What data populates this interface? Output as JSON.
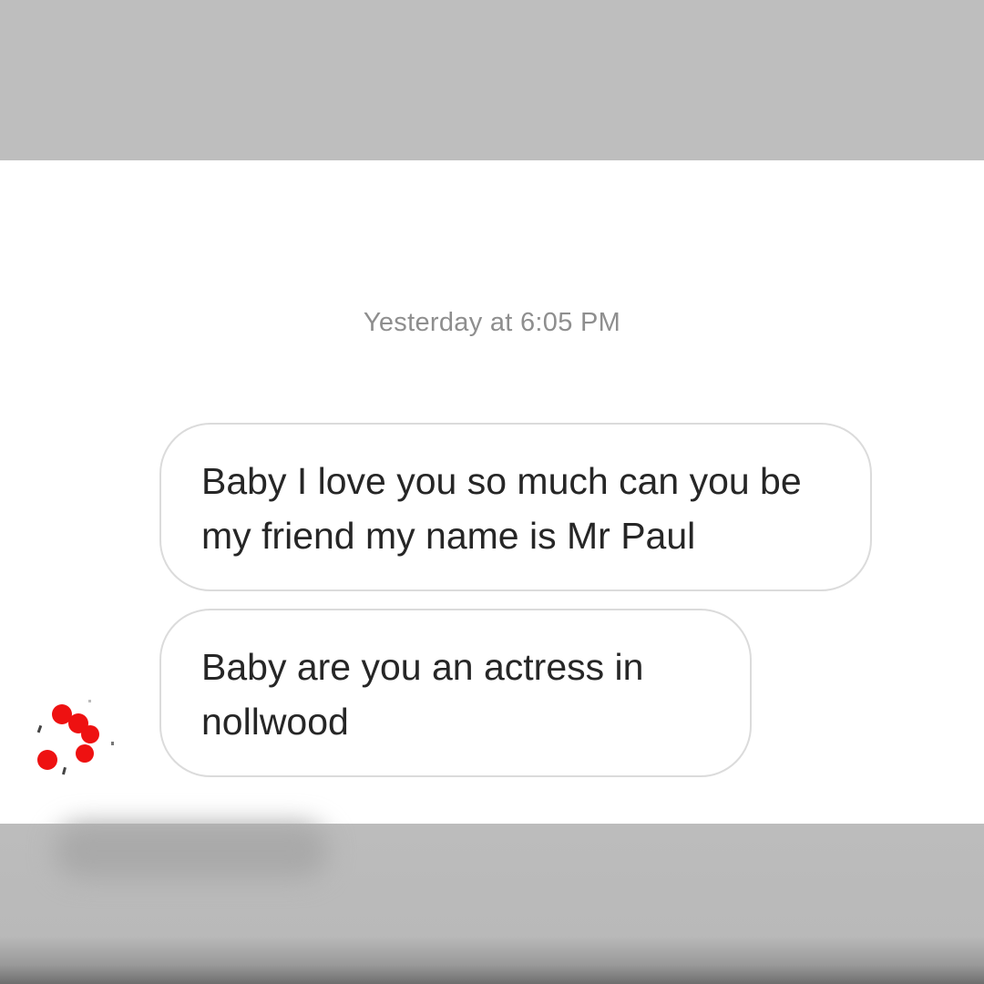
{
  "thread": {
    "timestamp": "Yesterday at 6:05 PM",
    "messages": [
      {
        "text": "Baby I love you so much can you be my friend my name is Mr Paul"
      },
      {
        "text": "Baby are you an actress in nollwood"
      }
    ]
  },
  "colors": {
    "band": "#bebebe",
    "panel": "#ffffff",
    "timestamp": "#8e8e8e",
    "bubble_border": "#dbdbdb",
    "message_text": "#262626",
    "avatar_accent": "#ee1111"
  },
  "icons": {
    "sender_avatar": "sender-avatar-icon"
  }
}
